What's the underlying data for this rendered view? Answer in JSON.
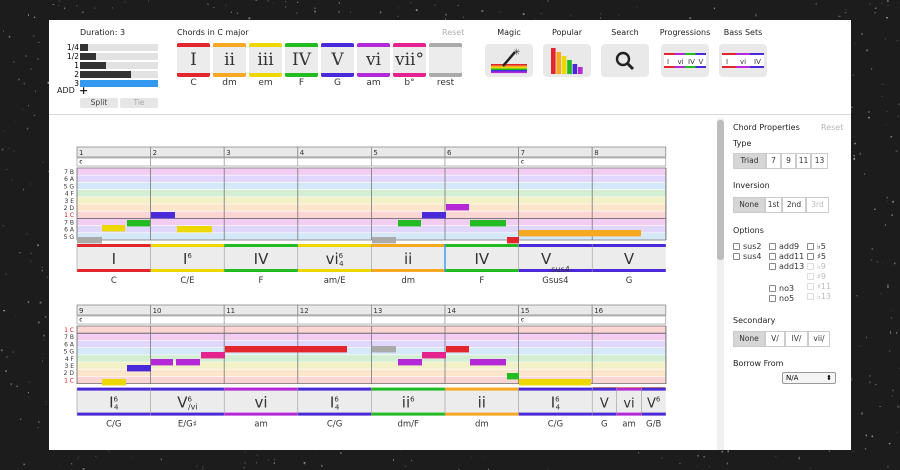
{
  "toolbar": {
    "duration": {
      "title": "Duration: 3",
      "rows": [
        {
          "label": "1/4",
          "fill": 0.1,
          "color": "#333333"
        },
        {
          "label": "1/2",
          "fill": 0.2,
          "color": "#333333"
        },
        {
          "label": "1",
          "fill": 0.33,
          "color": "#333333"
        },
        {
          "label": "2",
          "fill": 0.66,
          "color": "#333333"
        },
        {
          "label": "3",
          "fill": 1.0,
          "color": "#3399ee"
        }
      ],
      "add_label": "ADD",
      "add_icon": "+",
      "split_label": "Split",
      "tie_label": "Tie"
    },
    "chords": {
      "title": "Chords in C major",
      "reset_label": "Reset",
      "items": [
        {
          "numeral": "I",
          "name": "C",
          "color": "#e3262e"
        },
        {
          "numeral": "ii",
          "name": "dm",
          "color": "#f7a823"
        },
        {
          "numeral": "iii",
          "name": "em",
          "color": "#ecd800"
        },
        {
          "numeral": "IV",
          "name": "F",
          "color": "#22bb22"
        },
        {
          "numeral": "V",
          "name": "G",
          "color": "#4a2ad8"
        },
        {
          "numeral": "vi",
          "name": "am",
          "color": "#b428d8"
        },
        {
          "numeral": "vii°",
          "name": "b°",
          "color": "#e4238f"
        },
        {
          "numeral": "",
          "name": "rest",
          "color": "#aaaaaa"
        }
      ]
    },
    "tools": [
      {
        "title": "Magic",
        "icon": "magic-wand-icon"
      },
      {
        "title": "Popular",
        "icon": "bar-chart-icon"
      },
      {
        "title": "Search",
        "icon": "search-icon"
      },
      {
        "title": "Progressions",
        "icon": "progression-icon"
      },
      {
        "title": "Bass Sets",
        "icon": "bass-sets-icon"
      }
    ]
  },
  "score": {
    "systems": [
      {
        "measures": [
          "1",
          "2",
          "3",
          "4",
          "5",
          "6",
          "7",
          "8"
        ],
        "time_sig": "𝄴",
        "note_labels": [
          "7 B",
          "6 A",
          "5 G",
          "4 F",
          "3 E",
          "2 D",
          "1 C",
          "7 B",
          "6 A",
          "5 G"
        ],
        "chords": [
          {
            "numeral": "I",
            "sup": "",
            "sub": "",
            "name": "C",
            "color": "#e3262e",
            "span": 1
          },
          {
            "numeral": "I",
            "sup": "6",
            "sub": "",
            "name": "C/E",
            "color": "#ecd800",
            "span": 1
          },
          {
            "numeral": "IV",
            "sup": "",
            "sub": "",
            "name": "F",
            "color": "#22bb22",
            "span": 1
          },
          {
            "numeral": "vi",
            "sup": "6",
            "sub": "4",
            "name": "am/E",
            "color": "#ecd800",
            "span": 1
          },
          {
            "numeral": "ii",
            "sup": "",
            "sub": "",
            "name": "dm",
            "color": "#f7a823",
            "span": 1
          },
          {
            "numeral": "IV",
            "sup": "",
            "sub": "",
            "name": "F",
            "color": "#22bb22",
            "span": 1
          },
          {
            "numeral": "V",
            "sup": "",
            "sub": "sus4",
            "name": "Gsus4",
            "color": "#4a2ad8",
            "span": 1
          },
          {
            "numeral": "V",
            "sup": "",
            "sub": "",
            "name": "G",
            "color": "#4a2ad8",
            "span": 1
          }
        ]
      },
      {
        "measures": [
          "9",
          "10",
          "11",
          "12",
          "13",
          "14",
          "15",
          "16"
        ],
        "time_sig": "𝄴",
        "note_labels": [
          "1 C",
          "7 B",
          "6 A",
          "5 G",
          "4 F",
          "3 E",
          "2 D",
          "1 C"
        ],
        "chords": [
          {
            "numeral": "I",
            "sup": "6",
            "sub": "4",
            "name": "C/G",
            "color": "#4a2ad8",
            "span": 1
          },
          {
            "numeral": "V",
            "sup": "6",
            "sub": "/vi",
            "name": "E/G♯",
            "color": "#4a2ad8",
            "span": 1
          },
          {
            "numeral": "vi",
            "sup": "",
            "sub": "",
            "name": "am",
            "color": "#b428d8",
            "span": 1
          },
          {
            "numeral": "I",
            "sup": "6",
            "sub": "4",
            "name": "C/G",
            "color": "#4a2ad8",
            "span": 1
          },
          {
            "numeral": "ii",
            "sup": "6",
            "sub": "",
            "name": "dm/F",
            "color": "#22bb22",
            "span": 1
          },
          {
            "numeral": "ii",
            "sup": "",
            "sub": "",
            "name": "dm",
            "color": "#f7a823",
            "span": 1
          },
          {
            "numeral": "I",
            "sup": "6",
            "sub": "4",
            "name": "C/G",
            "color": "#4a2ad8",
            "span": 1
          },
          {
            "numeral": "V",
            "sup": "",
            "sub": "",
            "name": "G",
            "color": "#4a2ad8",
            "span": 0.33
          },
          {
            "numeral": "vi",
            "sup": "",
            "sub": "",
            "name": "am",
            "color": "#b428d8",
            "span": 0.34
          },
          {
            "numeral": "V",
            "sup": "6",
            "sub": "",
            "name": "G/B",
            "color": "#4a2ad8",
            "span": 0.33
          }
        ]
      }
    ]
  },
  "sidebar": {
    "title": "Chord Properties",
    "reset_label": "Reset",
    "type": {
      "label": "Type",
      "options": [
        "Triad",
        "7",
        "9",
        "11",
        "13"
      ],
      "selected": 0
    },
    "inversion": {
      "label": "Inversion",
      "options": [
        "None",
        "1st",
        "2nd",
        "3rd"
      ],
      "selected": 0,
      "disabled": [
        3
      ]
    },
    "options": {
      "label": "Options",
      "col1": [
        {
          "text": "sus2",
          "disabled": false
        },
        {
          "text": "sus4",
          "disabled": false
        }
      ],
      "col2": [
        {
          "text": "add9",
          "disabled": false
        },
        {
          "text": "add11",
          "disabled": false
        },
        {
          "text": "add13",
          "disabled": false
        },
        {
          "text": "no3",
          "disabled": false
        },
        {
          "text": "no5",
          "disabled": false
        }
      ],
      "col3": [
        {
          "text": "♭5",
          "disabled": false
        },
        {
          "text": "♯5",
          "disabled": false
        },
        {
          "text": "♭9",
          "disabled": true
        },
        {
          "text": "♯9",
          "disabled": true
        },
        {
          "text": "♯11",
          "disabled": true
        },
        {
          "text": "♭13",
          "disabled": true
        }
      ]
    },
    "secondary": {
      "label": "Secondary",
      "options": [
        "None",
        "V/",
        "IV/",
        "vii/"
      ],
      "selected": 0
    },
    "borrow": {
      "label": "Borrow From",
      "value": "N/A"
    }
  }
}
